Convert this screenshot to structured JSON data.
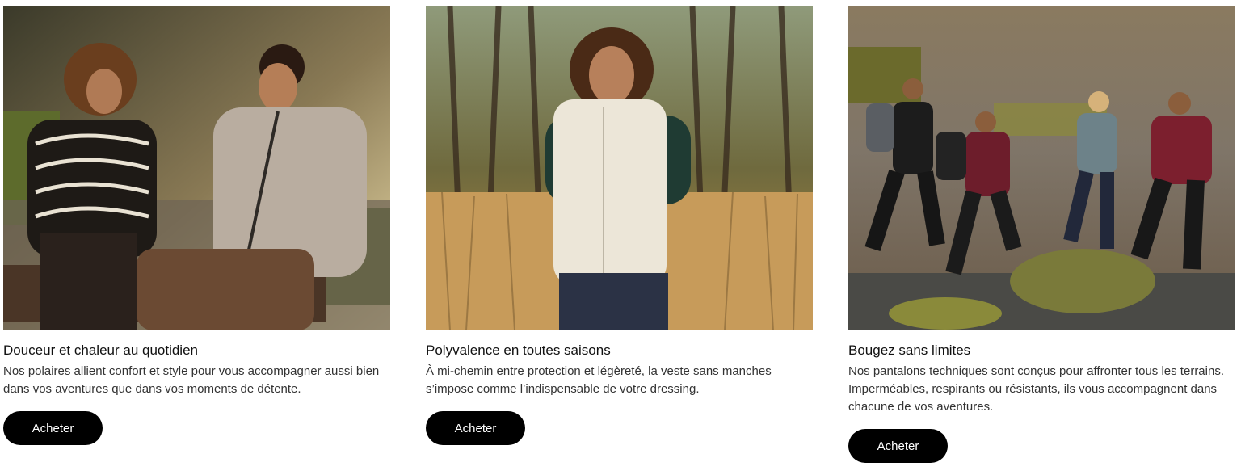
{
  "cards": [
    {
      "image_alt_icon": "photo-couple-fleece",
      "title": "Douceur et chaleur au quotidien",
      "description": "Nos polaires allient confort et style pour vous accompagner aussi bien dans vos aventures que dans vos moments de détente.",
      "button_label": "Acheter"
    },
    {
      "image_alt_icon": "photo-woman-vest",
      "title": "Polyvalence en toutes saisons",
      "description": "À mi-chemin entre protection et légèreté, la veste sans manches s’impose comme l’indispensable de votre dressing.",
      "button_label": "Acheter"
    },
    {
      "image_alt_icon": "photo-hikers-stream",
      "title": "Bougez sans limites",
      "description": "Nos pantalons techniques sont conçus pour affronter tous les terrains. Imperméables, respirants ou résistants, ils vous accompagnent dans chacune de vos aventures.",
      "button_label": "Acheter"
    }
  ],
  "colors": {
    "button_bg": "#000000",
    "button_text": "#ffffff",
    "title_text": "#111111",
    "body_text": "#333333"
  }
}
